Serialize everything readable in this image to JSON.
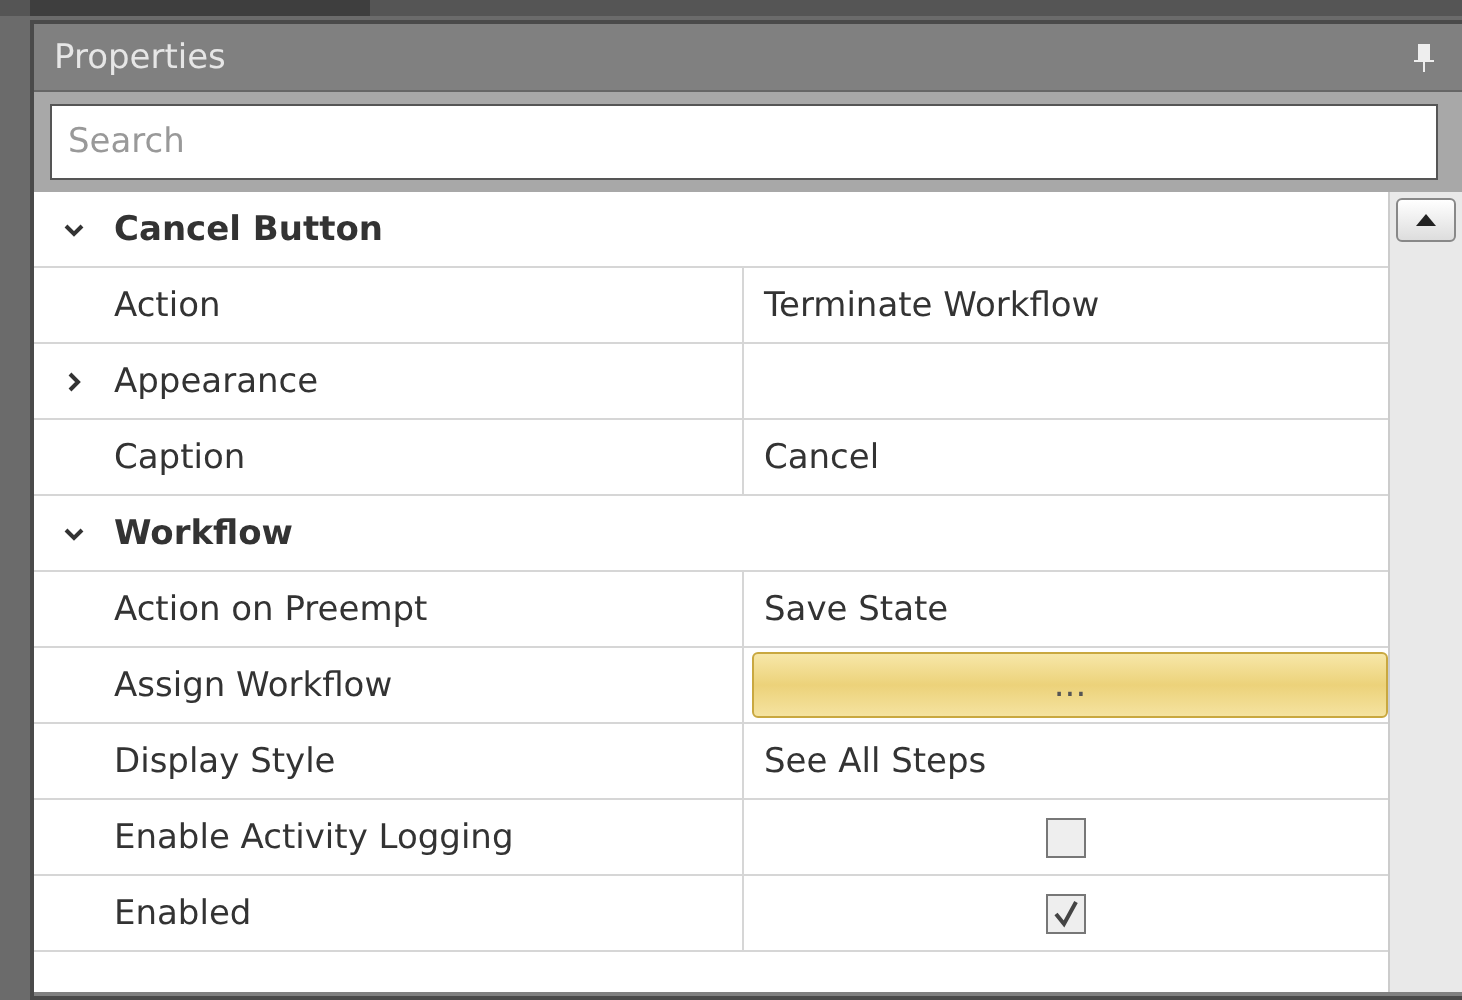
{
  "panel": {
    "title": "Properties"
  },
  "search": {
    "placeholder": "Search"
  },
  "categories": [
    {
      "name": "Cancel Button",
      "expanded": true,
      "properties": [
        {
          "name": "Action",
          "kind": "text",
          "value": "Terminate Workflow"
        },
        {
          "name": "Appearance",
          "kind": "text",
          "expanded": false
        },
        {
          "name": "Caption",
          "kind": "text",
          "value": "Cancel"
        }
      ]
    },
    {
      "name": "Workflow",
      "expanded": true,
      "properties": [
        {
          "name": "Action on Preempt",
          "kind": "text",
          "value": "Save State"
        },
        {
          "name": "Assign Workflow",
          "kind": "button",
          "value": "..."
        },
        {
          "name": "Display Style",
          "kind": "text",
          "value": "See All Steps"
        },
        {
          "name": "Enable Activity Logging",
          "kind": "checkbox",
          "checked": false
        },
        {
          "name": "Enabled",
          "kind": "checkbox",
          "checked": true
        }
      ]
    }
  ]
}
